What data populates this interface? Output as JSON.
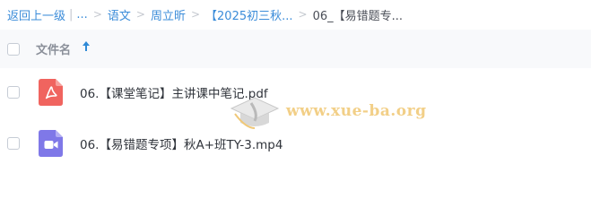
{
  "breadcrumb": {
    "back": "返回上一级",
    "ellipsis": "...",
    "crumb1": "语文",
    "crumb2": "周立昕",
    "crumb3": "【2025初三秋...",
    "current": "06_【易错题专..."
  },
  "header": {
    "filename_label": "文件名"
  },
  "files": [
    {
      "name": "06.【课堂笔记】主讲课中笔记.pdf",
      "icon": "pdf-icon",
      "icon_color": "#f0645f"
    },
    {
      "name": "06.【易错题专项】秋A+班TY-3.mp4",
      "icon": "video-icon",
      "icon_color": "#7f78e8"
    }
  ],
  "watermark": {
    "text": "www.xue-ba.org"
  },
  "colors": {
    "link": "#3b8cd9",
    "sort_arrow": "#2f8ad6",
    "header_bg": "#f8f9fb"
  }
}
